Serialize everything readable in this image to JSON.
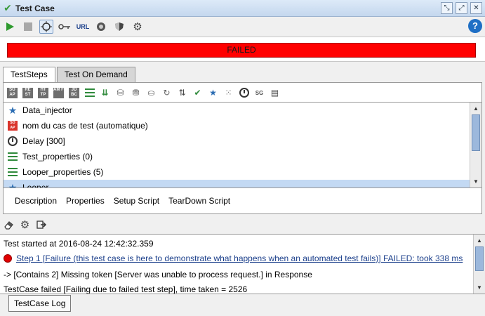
{
  "window": {
    "title": "Test Case",
    "controls": [
      "restore-icon",
      "maximize-icon",
      "close-icon"
    ]
  },
  "toolbar": {
    "icons": [
      "run-icon",
      "stop-icon",
      "target-icon",
      "key-icon",
      "url-icon",
      "network-icon",
      "shield-icon",
      "gear-icon"
    ],
    "url_label": "URL",
    "help_label": "?"
  },
  "status": {
    "label": "FAILED",
    "color": "#ff0000"
  },
  "tabs": [
    {
      "label": "TestSteps",
      "active": true
    },
    {
      "label": "Test On Demand",
      "active": false
    }
  ],
  "step_toolbar": {
    "icons": [
      "soap-step-icon",
      "rest-step-icon",
      "http-step-icon",
      "amf-step-icon",
      "jdbc-step-icon",
      "properties-icon",
      "property-transfer-icon",
      "datasource-icon",
      "datasink-icon",
      "datagen-icon",
      "loop-icon",
      "goto-icon",
      "assertion-icon",
      "favorite-icon",
      "grid-icon",
      "clock-icon",
      "script-icon",
      "comment-icon"
    ],
    "box_labels": [
      "SO AP",
      "RE ST",
      "HT TP",
      "AM F",
      "JD BC"
    ]
  },
  "steps": [
    {
      "label": "Data_injector",
      "icon": "star-icon"
    },
    {
      "label": "nom du cas de test (automatique)",
      "icon": "soap-icon",
      "icon_text": "SO AP"
    },
    {
      "label": "Delay [300]",
      "icon": "clock-icon"
    },
    {
      "label": "Test_properties (0)",
      "icon": "properties-icon"
    },
    {
      "label": "Looper_properties (5)",
      "icon": "properties-icon"
    },
    {
      "label": "Looper",
      "icon": "star-icon",
      "selected": true
    }
  ],
  "steps_scroll": {
    "thumb_fraction": 0.6
  },
  "subtabs": [
    "Description",
    "Properties",
    "Setup Script",
    "TearDown Script"
  ],
  "log_toolbar": {
    "icons": [
      "eraser-icon",
      "gear-icon",
      "export-icon"
    ]
  },
  "log": {
    "lines": [
      "Test started at 2016-08-24 12:42:32.359",
      "Step 1 [Failure (this test case is here to demonstrate what happens when an automated test fails)] FAILED: took 338 ms",
      "-> [Contains 2] Missing token [Server was unable to process request.] in Response",
      "TestCase failed [Failing due to failed test step], time taken = 2526"
    ],
    "tab_label": "TestCase Log"
  },
  "log_scroll": {
    "thumb_fraction": 0.7
  }
}
